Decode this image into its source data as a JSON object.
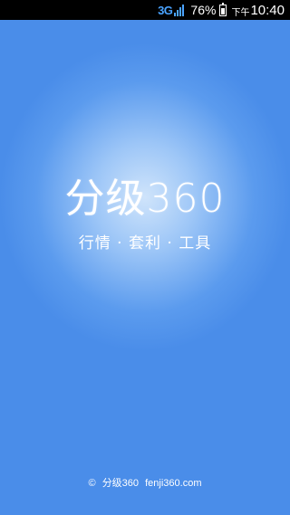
{
  "status_bar": {
    "network": "3G",
    "battery_percent": "76%",
    "ampm": "下午",
    "time": "10:40"
  },
  "splash": {
    "logo_text": "分级360",
    "tagline": "行情 · 套利 · 工具",
    "copyright_symbol": "©",
    "footer_brand": "分级360",
    "footer_url": "fenji360.com"
  },
  "colors": {
    "background_outer": "#4a8de9",
    "background_center": "#cfe4fb",
    "network_accent": "#4aa3ff"
  }
}
